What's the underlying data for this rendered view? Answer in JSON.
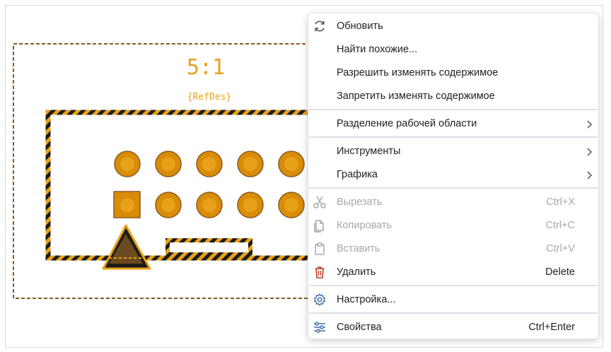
{
  "canvas": {
    "scale_label": "5:1",
    "refdes_label": "{RefDes}"
  },
  "menu": {
    "refresh": "Обновить",
    "find_similar": "Найти похожие...",
    "allow_edit": "Разрешить изменять содержимое",
    "forbid_edit": "Запретить изменять содержимое",
    "split_workspace": "Разделение рабочей области",
    "tools": "Инструменты",
    "graphics": "Графика",
    "cut": "Вырезать",
    "cut_shortcut": "Ctrl+X",
    "copy": "Копировать",
    "copy_shortcut": "Ctrl+C",
    "paste": "Вставить",
    "paste_shortcut": "Ctrl+V",
    "delete": "Удалить",
    "delete_shortcut": "Delete",
    "settings": "Настройка...",
    "properties": "Свойства",
    "properties_shortcut": "Ctrl+Enter"
  },
  "colors": {
    "accent_orange": "#e8a21a",
    "pad_orange": "#d98c07",
    "outline_brown": "#8a5a22",
    "icon_blue": "#3f6fa8",
    "delete_red": "#c0392b",
    "disabled_gray": "#a4a9ae"
  }
}
